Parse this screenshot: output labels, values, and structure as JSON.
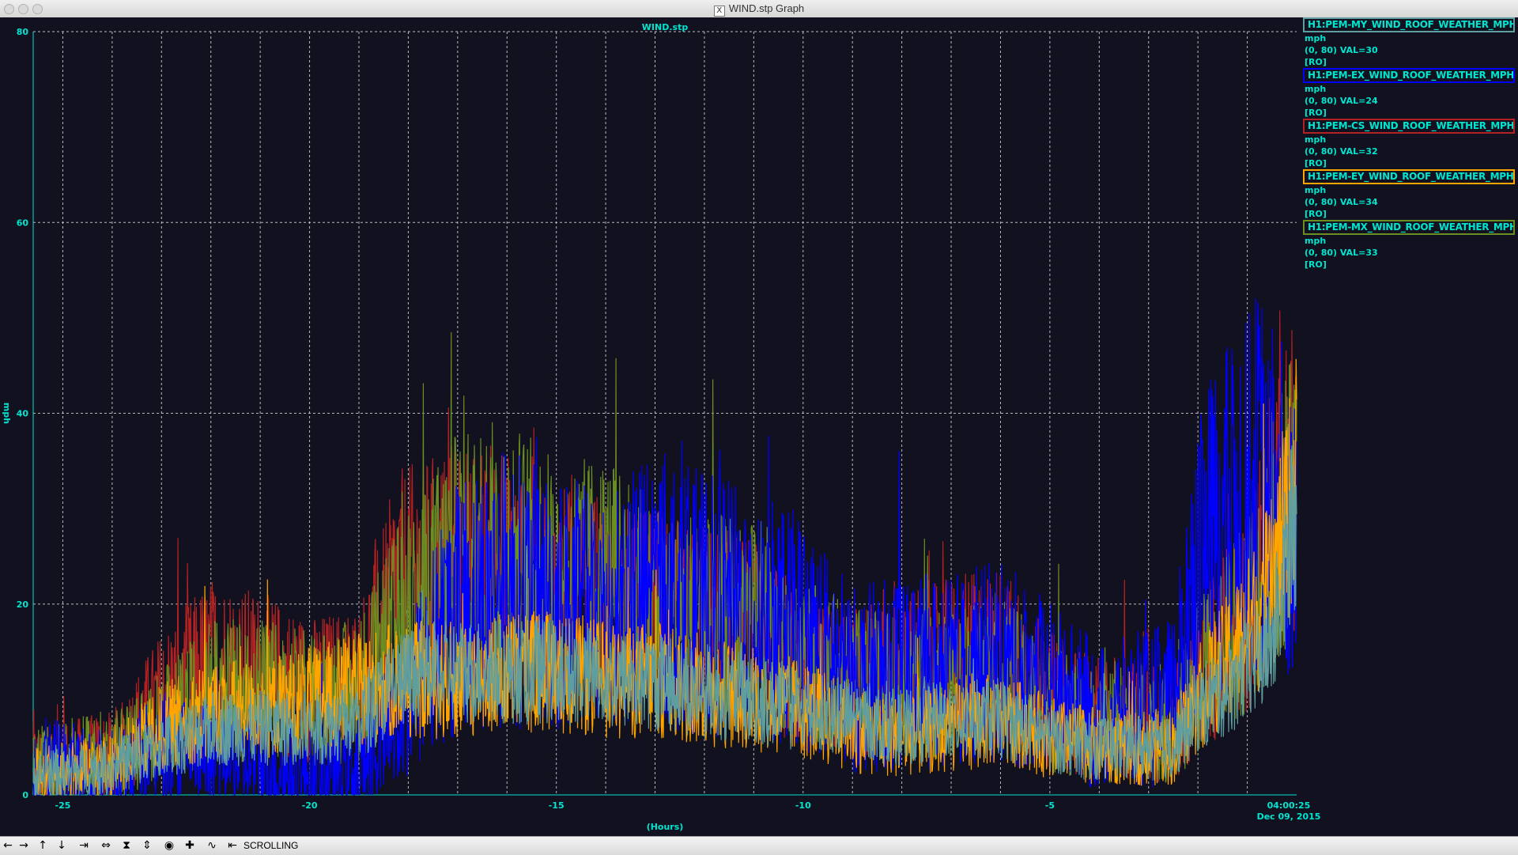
{
  "window": {
    "title": "WIND.stp Graph",
    "x_icon": "X"
  },
  "legend": [
    {
      "channel": "H1:PEM-MY_WIND_ROOF_WEATHER_MPH",
      "unit": "mph",
      "range": "(0, 80) VAL=30",
      "mode": "[RO]",
      "color": "#5f9ea0"
    },
    {
      "channel": "H1:PEM-EX_WIND_ROOF_WEATHER_MPH",
      "unit": "mph",
      "range": "(0, 80) VAL=24",
      "mode": "[RO]",
      "color": "#0000ff"
    },
    {
      "channel": "H1:PEM-CS_WIND_ROOF_WEATHER_MPH",
      "unit": "mph",
      "range": "(0, 80) VAL=32",
      "mode": "[RO]",
      "color": "#b22222"
    },
    {
      "channel": "H1:PEM-EY_WIND_ROOF_WEATHER_MPH",
      "unit": "mph",
      "range": "(0, 80) VAL=34",
      "mode": "[RO]",
      "color": "#ffa500"
    },
    {
      "channel": "H1:PEM-MX_WIND_ROOF_WEATHER_MPH",
      "unit": "mph",
      "range": "(0, 80) VAL=33",
      "mode": "[RO]",
      "color": "#6b8e23"
    }
  ],
  "toolbar": {
    "buttons": [
      "pan-left-icon",
      "pan-right-icon",
      "pan-up-icon",
      "pan-down-icon",
      "zoom-x-in-icon",
      "zoom-x-out-icon",
      "zoom-y-in-icon",
      "zoom-y-out-icon",
      "reset-icon",
      "add-icon",
      "fft-icon",
      "back-icon"
    ],
    "mode": "SCROLLING"
  },
  "chart_data": {
    "type": "line",
    "title": "WIND.stp",
    "xlabel": "(Hours)",
    "ylabel": "mph",
    "x_ticks": [
      "-25",
      "-20",
      "-15",
      "-10",
      "-5"
    ],
    "end_time": "04:00:25",
    "end_date": "Dec 09, 2015",
    "y_ticks": [
      "0",
      "20",
      "40",
      "60",
      "80"
    ],
    "xlim": [
      -25.6,
      0
    ],
    "ylim": [
      0,
      80
    ],
    "grid": true,
    "grid_x_step_hours": 1,
    "series": [
      {
        "name": "H1:PEM-CS_WIND_ROOF_WEATHER_MPH",
        "color": "#b22222",
        "jitter": 9,
        "x": [
          -25.6,
          -24,
          -23,
          -22,
          -21,
          -20,
          -19,
          -18.2,
          -17,
          -16,
          -15,
          -14,
          -13,
          -12,
          -11,
          -10,
          -9,
          -8,
          -7,
          -6,
          -5,
          -4,
          -3,
          -2.5,
          -2,
          -1,
          -0.5,
          0
        ],
        "y": [
          3,
          4,
          10,
          14,
          13,
          11,
          12,
          22,
          24,
          24,
          21,
          20,
          19,
          18,
          17,
          13,
          12,
          13,
          14,
          15,
          10,
          8,
          8,
          7,
          12,
          20,
          28,
          34
        ]
      },
      {
        "name": "H1:PEM-MX_WIND_ROOF_WEATHER_MPH",
        "color": "#6b8e23",
        "jitter": 9,
        "x": [
          -25.6,
          -24,
          -23,
          -22,
          -21,
          -20,
          -19,
          -18.2,
          -17,
          -16,
          -15,
          -14,
          -13,
          -12,
          -11,
          -10,
          -9,
          -8,
          -7,
          -6,
          -5,
          -4,
          -3,
          -2.5,
          -2,
          -1,
          -0.5,
          0
        ],
        "y": [
          3,
          4,
          7,
          11,
          11,
          10,
          11,
          18,
          25,
          26,
          23,
          23,
          20,
          19,
          18,
          14,
          12,
          11,
          12,
          13,
          9,
          7,
          8,
          7,
          12,
          20,
          27,
          33
        ]
      },
      {
        "name": "H1:PEM-EX_WIND_ROOF_WEATHER_MPH",
        "color": "#0000ff",
        "jitter": 11,
        "x": [
          -25.6,
          -24,
          -23,
          -22,
          -21,
          -20,
          -19,
          -18.2,
          -17,
          -16,
          -15,
          -14,
          -13,
          -12,
          -11,
          -10,
          -9,
          -8,
          -7,
          -6,
          -5,
          -4,
          -3,
          -2.5,
          -2,
          -1,
          -0.5,
          0
        ],
        "y": [
          3,
          2,
          5,
          4,
          3,
          2,
          3,
          8,
          20,
          22,
          20,
          19,
          22,
          20,
          19,
          17,
          12,
          13,
          13,
          14,
          11,
          8,
          9,
          10,
          25,
          32,
          34,
          24
        ]
      },
      {
        "name": "H1:PEM-EY_WIND_ROOF_WEATHER_MPH",
        "color": "#ffa500",
        "jitter": 7,
        "x": [
          -25.6,
          -24,
          -23,
          -22,
          -21,
          -20,
          -19,
          -18.2,
          -17,
          -16,
          -15,
          -14,
          -13,
          -12,
          -11,
          -10,
          -9,
          -8,
          -7,
          -6,
          -5,
          -4,
          -3,
          -2.5,
          -2,
          -1,
          -0.5,
          0
        ],
        "y": [
          2,
          3,
          7,
          9,
          9,
          10,
          11,
          12,
          12,
          13,
          13,
          12,
          12,
          11,
          10,
          9,
          7,
          6,
          7,
          8,
          6,
          5,
          5,
          5,
          10,
          17,
          22,
          34
        ]
      },
      {
        "name": "H1:PEM-MY_WIND_ROOF_WEATHER_MPH",
        "color": "#5f9ea0",
        "jitter": 6,
        "x": [
          -25.6,
          -24,
          -23,
          -22,
          -21,
          -20,
          -19,
          -18.2,
          -17,
          -16,
          -15,
          -14,
          -13,
          -12,
          -11,
          -10,
          -9,
          -8,
          -7,
          -6,
          -5,
          -4,
          -3,
          -2.5,
          -2,
          -1,
          -0.5,
          0
        ],
        "y": [
          2,
          3,
          5,
          7,
          7,
          7,
          8,
          12,
          13,
          13,
          13,
          12,
          12,
          11,
          10,
          9,
          8,
          7,
          8,
          8,
          6,
          5,
          5,
          5,
          9,
          13,
          16,
          30
        ]
      }
    ]
  }
}
